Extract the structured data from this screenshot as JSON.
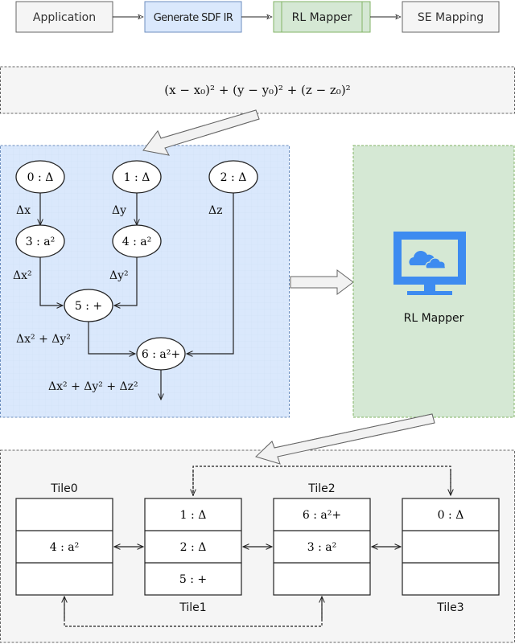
{
  "pipeline": {
    "steps": [
      {
        "label": "Application",
        "fill": "#f5f5f5",
        "stroke": "#666666"
      },
      {
        "label": "Generate SDF IR",
        "fill": "#dae8fc",
        "stroke": "#6c8ebf"
      },
      {
        "label": "RL Mapper",
        "fill": "#d5e8d4",
        "stroke": "#82b366"
      },
      {
        "label": "SE Mapping",
        "fill": "#f5f5f5",
        "stroke": "#666666"
      }
    ]
  },
  "formula": {
    "text": "(x − x₀)² + (y − y₀)² + (z − z₀)²"
  },
  "ir_graph": {
    "fill": "#dae8fc",
    "stroke": "#6c8ebf",
    "nodes": [
      {
        "id": "0",
        "label": "0 : Δ"
      },
      {
        "id": "1",
        "label": "1 : Δ"
      },
      {
        "id": "2",
        "label": "2 : Δ"
      },
      {
        "id": "3",
        "label": "3 : a²"
      },
      {
        "id": "4",
        "label": "4 : a²"
      },
      {
        "id": "5",
        "label": "5 : +"
      },
      {
        "id": "6",
        "label": "6 : a²+"
      }
    ],
    "edge_labels": {
      "dx": "Δx",
      "dy": "Δy",
      "dz": "Δz",
      "dx2": "Δx²",
      "dy2": "Δy²",
      "sum_xy": "Δx² + Δy²",
      "sum_xyz": "Δx² + Δy² + Δz²"
    }
  },
  "rl_mapper": {
    "fill": "#d5e8d4",
    "stroke": "#82b366",
    "label": "RL Mapper",
    "icon": "monitor-cloud-icon",
    "icon_color": "#3d8bf0"
  },
  "mapping": {
    "fill": "#f5f5f5",
    "stroke": "#666666",
    "tiles": [
      {
        "name": "Tile0",
        "slots": [
          "",
          "4 : a²",
          ""
        ]
      },
      {
        "name": "Tile1",
        "slots": [
          "1 : Δ",
          "2 : Δ",
          "5 : +"
        ]
      },
      {
        "name": "Tile2",
        "slots": [
          "6 : a²+",
          "3 : a²",
          ""
        ]
      },
      {
        "name": "Tile3",
        "slots": [
          "0 : Δ",
          "",
          ""
        ]
      }
    ]
  }
}
